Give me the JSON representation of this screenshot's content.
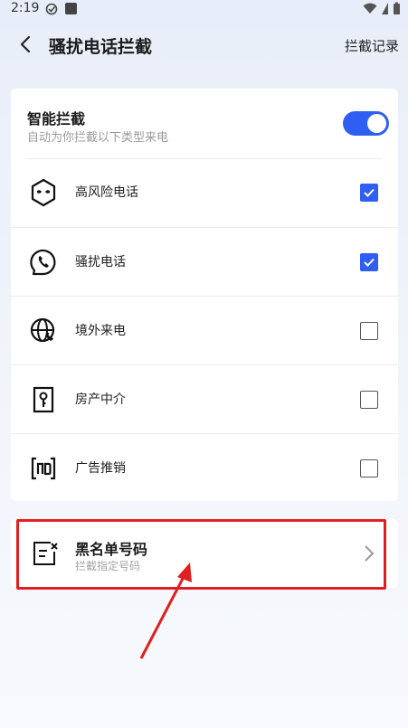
{
  "status_bar": {
    "time": "2:19"
  },
  "header": {
    "title": "骚扰电话拦截",
    "right_link": "拦截记录"
  },
  "smart_block": {
    "title": "智能拦截",
    "subtitle": "自动为你拦截以下类型来电",
    "enabled": true
  },
  "categories": [
    {
      "label": "高风险电话",
      "checked": true,
      "icon": "mask-icon"
    },
    {
      "label": "骚扰电话",
      "checked": true,
      "icon": "phone-circle-icon"
    },
    {
      "label": "境外来电",
      "checked": false,
      "icon": "globe-phone-icon"
    },
    {
      "label": "房产中介",
      "checked": false,
      "icon": "key-door-icon"
    },
    {
      "label": "广告推销",
      "checked": false,
      "icon": "ad-icon"
    }
  ],
  "blacklist": {
    "title": "黑名单号码",
    "subtitle": "拦截指定号码",
    "icon": "blacklist-icon"
  },
  "colors": {
    "accent": "#2f5ef2",
    "highlight": "#e02020"
  }
}
